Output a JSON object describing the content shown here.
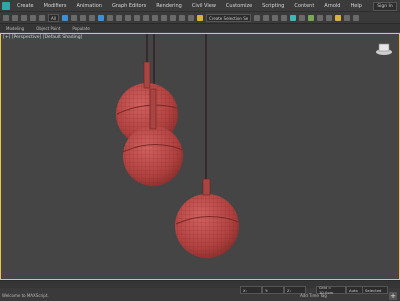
{
  "menu": {
    "items": [
      "Create",
      "Modifiers",
      "Animation",
      "Graph Editors",
      "Rendering",
      "Civil View",
      "Customize",
      "Scripting",
      "Content",
      "Arnold",
      "Help"
    ],
    "sign_in": "Sign In"
  },
  "toolbar": {
    "selection_filter": "All",
    "selection_set": "Create Selection Se"
  },
  "ribbon": {
    "tabs": [
      "Modeling",
      "Object Paint",
      "Populate"
    ]
  },
  "viewport": {
    "label": "[+] [Perspective] [Default Shading]"
  },
  "status": {
    "left_text": "Welcome to MAXScript.",
    "x": "X: ",
    "y": "Y: ",
    "z": "Z: ",
    "grid": "Grid = 10.0cm",
    "add_time_tag": "Add Time Tag",
    "auto": "Auto",
    "selected": "Selected"
  },
  "colors": {
    "sphere": "#b84a48",
    "viewport_border": "#f0c24b"
  }
}
